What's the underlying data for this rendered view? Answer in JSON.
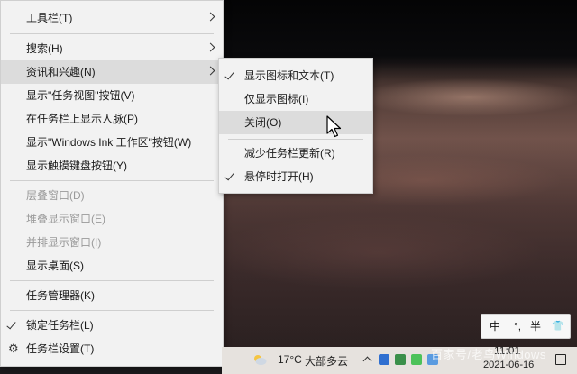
{
  "main_menu": {
    "items": [
      {
        "label": "工具栏(T)"
      },
      {
        "label": "搜索(H)"
      },
      {
        "label": "资讯和兴趣(N)"
      },
      {
        "label": "显示\"任务视图\"按钮(V)"
      },
      {
        "label": "在任务栏上显示人脉(P)"
      },
      {
        "label": "显示\"Windows Ink 工作区\"按钮(W)"
      },
      {
        "label": "显示触摸键盘按钮(Y)"
      },
      {
        "label": "层叠窗口(D)"
      },
      {
        "label": "堆叠显示窗口(E)"
      },
      {
        "label": "并排显示窗口(I)"
      },
      {
        "label": "显示桌面(S)"
      },
      {
        "label": "任务管理器(K)"
      },
      {
        "label": "锁定任务栏(L)"
      },
      {
        "label": "任务栏设置(T)"
      }
    ]
  },
  "sub_menu": {
    "items": [
      {
        "label": "显示图标和文本(T)"
      },
      {
        "label": "仅显示图标(I)"
      },
      {
        "label": "关闭(O)"
      },
      {
        "label": "减少任务栏更新(R)"
      },
      {
        "label": "悬停时打开(H)"
      }
    ]
  },
  "ime": {
    "lang": "中",
    "punct": "°,",
    "width": "半",
    "shirt": "👕"
  },
  "taskbar": {
    "weather_temp": "17°C",
    "weather_desc": "大部多云",
    "time": "11:01",
    "date": "2021-06-16"
  },
  "watermark": "百家号/老鸟Windows"
}
